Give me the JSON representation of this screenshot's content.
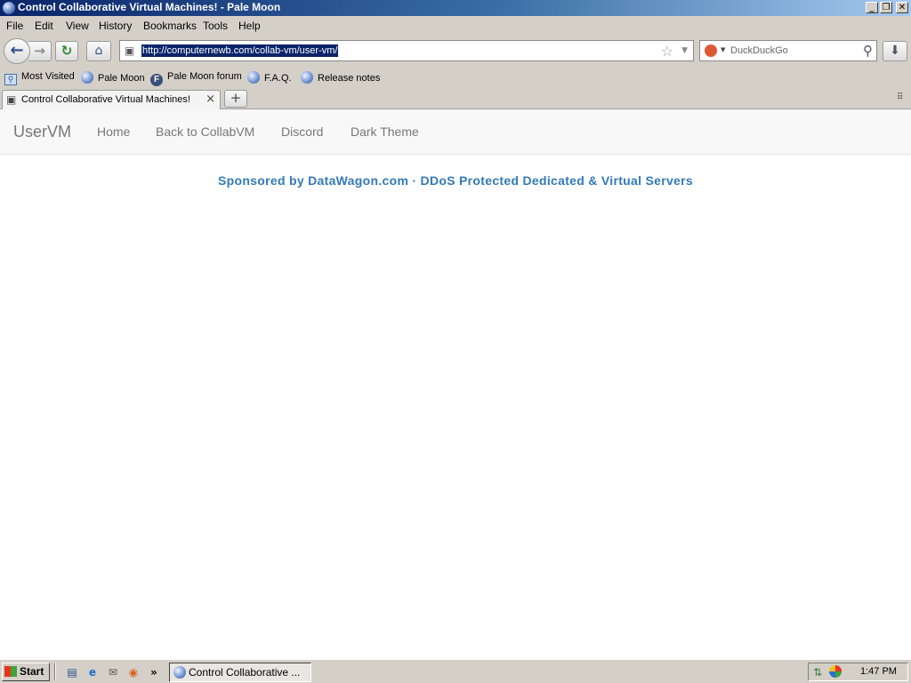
{
  "window": {
    "title": "Control Collaborative Virtual Machines! - Pale Moon",
    "controls": {
      "minimize": "_",
      "maximize": "❐",
      "close": "✕"
    }
  },
  "menu": [
    "File",
    "Edit",
    "View",
    "History",
    "Bookmarks",
    "Tools",
    "Help"
  ],
  "toolbar": {
    "url": "http://computernewb.com/collab-vm/user-vm/",
    "search_placeholder": "DuckDuckGo"
  },
  "bookmarks": [
    {
      "label": "Most Visited",
      "icon": "most-visited-icon"
    },
    {
      "label": "Pale Moon",
      "icon": "globe-icon"
    },
    {
      "label": "Pale Moon forum",
      "icon": "forum-icon"
    },
    {
      "label": "F.A.Q.",
      "icon": "globe-icon"
    },
    {
      "label": "Release notes",
      "icon": "globe-icon"
    }
  ],
  "tab": {
    "label": "Control Collaborative Virtual Machines!",
    "close": "×",
    "new": "+"
  },
  "site": {
    "brand": "UserVM",
    "nav": [
      "Home",
      "Back to CollabVM",
      "Discord",
      "Dark Theme"
    ],
    "sponsor": "Sponsored by DataWagon.com · DDoS Protected Dedicated & Virtual Servers"
  },
  "taskbar": {
    "start": "Start",
    "task": "Control Collaborative ...",
    "overflow": "»",
    "clock": "1:47 PM"
  }
}
